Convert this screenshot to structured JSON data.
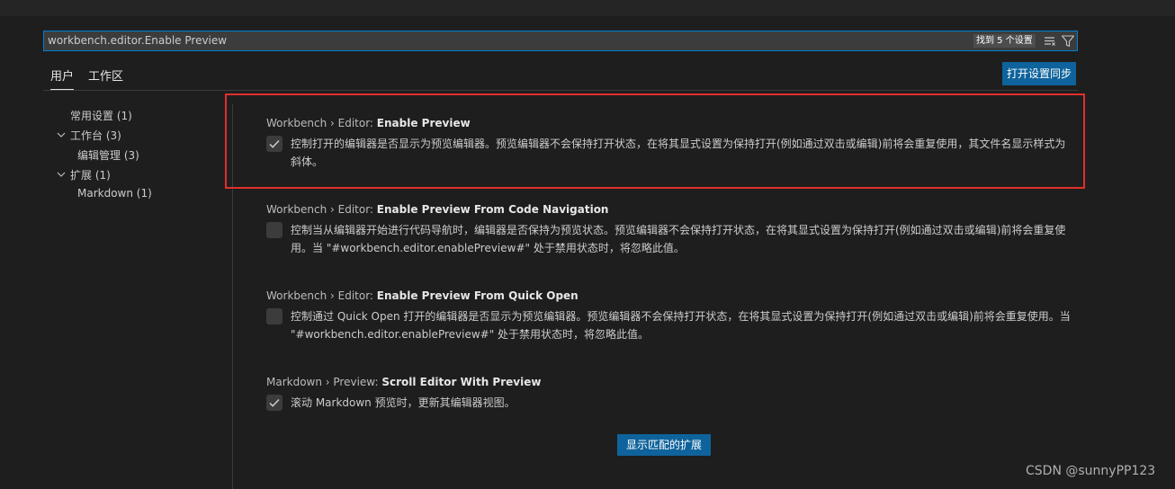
{
  "search": {
    "value": "workbench.editor.Enable Preview",
    "result_count": "找到 5 个设置",
    "icons": [
      "clear-filter-icon",
      "filter-icon"
    ]
  },
  "tabs": [
    {
      "label": "用户",
      "active": true
    },
    {
      "label": "工作区",
      "active": false
    }
  ],
  "sync_button": "打开设置同步",
  "toc": [
    {
      "label": "常用设置",
      "count": "(1)"
    },
    {
      "label": "工作台",
      "count": "(3)",
      "expanded": true
    },
    {
      "label": "编辑管理",
      "count": "(3)"
    },
    {
      "label": "扩展",
      "count": "(1)",
      "expanded": true
    },
    {
      "label": "Markdown",
      "count": "(1)"
    }
  ],
  "settings": [
    {
      "category": "Workbench › Editor: ",
      "name": "Enable Preview",
      "checked": true,
      "description": "控制打开的编辑器是否显示为预览编辑器。预览编辑器不会保持打开状态，在将其显式设置为保持打开(例如通过双击或编辑)前将会重复使用，其文件名显示样式为斜体。"
    },
    {
      "category": "Workbench › Editor: ",
      "name": "Enable Preview From Code Navigation",
      "checked": false,
      "description": "控制当从编辑器开始进行代码导航时，编辑器是否保持为预览状态。预览编辑器不会保持打开状态，在将其显式设置为保持打开(例如通过双击或编辑)前将会重复使用。当 \"#workbench.editor.enablePreview#\" 处于禁用状态时，将忽略此值。"
    },
    {
      "category": "Workbench › Editor: ",
      "name": "Enable Preview From Quick Open",
      "checked": false,
      "description": "控制通过 Quick Open 打开的编辑器是否显示为预览编辑器。预览编辑器不会保持打开状态，在将其显式设置为保持打开(例如通过双击或编辑)前将会重复使用。当 \"#workbench.editor.enablePreview#\" 处于禁用状态时，将忽略此值。"
    },
    {
      "category": "Markdown › Preview: ",
      "name": "Scroll Editor With Preview",
      "checked": true,
      "description": "滚动 Markdown 预览时，更新其编辑器视图。"
    }
  ],
  "extensions_button": "显示匹配的扩展",
  "watermark": "CSDN @sunnyPP123",
  "colors": {
    "background": "#1e1e1e",
    "accent_button": "#0e639c",
    "focus_border": "#007fd4",
    "highlight_box": "#e0302b"
  }
}
